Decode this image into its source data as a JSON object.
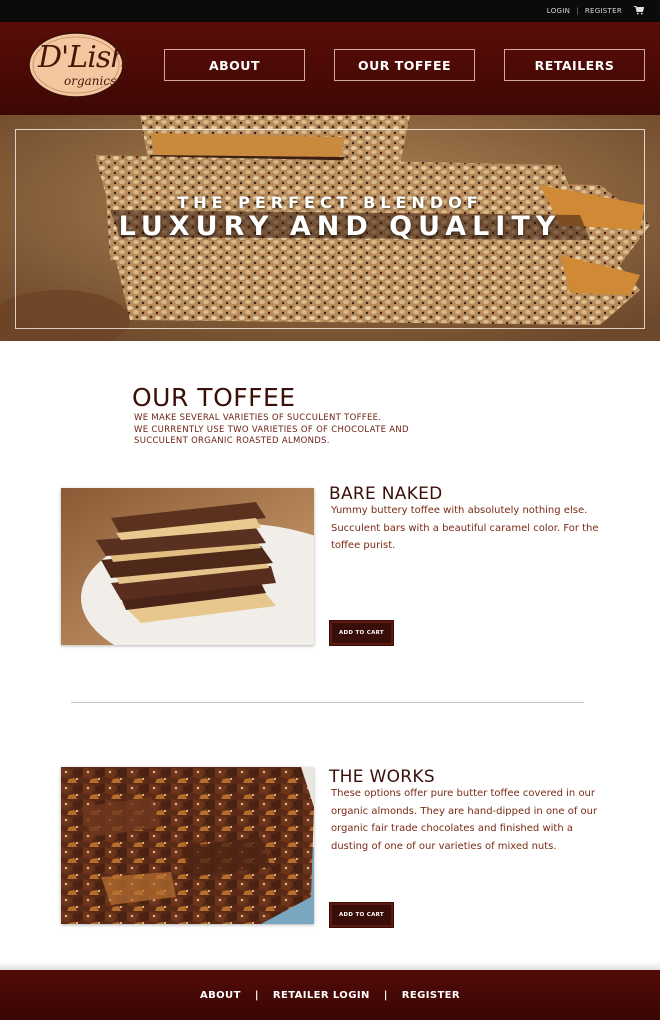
{
  "topbar": {
    "login": "LOGIN",
    "separator": "|",
    "register": "REGISTER",
    "cart_icon": "cart-icon"
  },
  "header": {
    "logo_brand": "D'Lish",
    "logo_sub": "organics",
    "nav": [
      {
        "label": "ABOUT"
      },
      {
        "label": "OUR TOFFEE"
      },
      {
        "label": "RETAILERS"
      }
    ]
  },
  "hero": {
    "line1": "THE PERFECT BLENDOF",
    "line2": "LUXURY AND QUALITY"
  },
  "intro": {
    "title": "OUR TOFFEE",
    "lines": [
      "WE MAKE SEVERAL VARIETIES  OF SUCCULENT TOFFEE.",
      "WE CURRENTLY USE TWO VARIETIES OF OF CHOCOLATE AND",
      "SUCCULENT ORGANIC ROASTED ALMONDS."
    ]
  },
  "products": [
    {
      "title": "BARE NAKED",
      "description": "Yummy buttery toffee with absolutely nothing else. Succulent bars with a beautiful caramel color. For the toffee purist.",
      "cart_label": "ADD TO CART"
    },
    {
      "title": "THE WORKS",
      "description": "These options offer pure butter toffee covered in our organic almonds. They are hand-dipped in one of our organic fair trade chocolates and finished with a dusting of one of our varieties of mixed nuts.",
      "cart_label": "ADD TO CART"
    }
  ],
  "footer": {
    "about": "ABOUT",
    "sep": "|",
    "retailer_login": "RETAILER LOGIN",
    "register": "REGISTER"
  },
  "colors": {
    "brand_dark": "#3a0e08",
    "header_red": "#5a0d08",
    "text_brown": "#7a2a14",
    "logo_peach": "#f4c7a0"
  }
}
